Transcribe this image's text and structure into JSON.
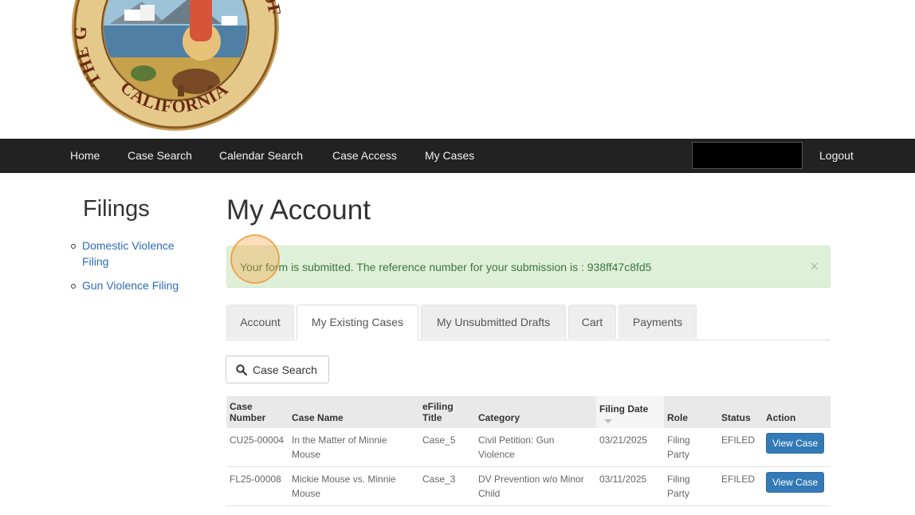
{
  "seal": {
    "text_left": "THE G",
    "text_right": "ATE OF",
    "text_bottom": "CALIFORNIA"
  },
  "nav": {
    "items": [
      "Home",
      "Case Search",
      "Calendar Search",
      "Case Access",
      "My Cases"
    ],
    "logout": "Logout"
  },
  "sidebar": {
    "title": "Filings",
    "links": [
      "Domestic Violence Filing",
      "Gun Violence Filing"
    ]
  },
  "main": {
    "title": "My Account",
    "alert": {
      "message": "Your form is submitted. The reference number for your submission is : 938ff47c8fd5",
      "close": "×"
    },
    "tabs": [
      "Account",
      "My Existing Cases",
      "My Unsubmitted Drafts",
      "Cart",
      "Payments"
    ],
    "active_tab": "My Existing Cases",
    "search_button": "Case Search",
    "table": {
      "headers": [
        "Case Number",
        "Case Name",
        "eFiling Title",
        "Category",
        "Filing Date",
        "Role",
        "Status",
        "Action"
      ],
      "rows": [
        {
          "case_number": "CU25-00004",
          "case_name": "In the Matter of Minnie Mouse",
          "efiling_title": "Case_5",
          "category": "Civil Petition: Gun Violence",
          "filing_date": "03/21/2025",
          "role": "Filing Party",
          "status": "EFILED",
          "action": "View Case"
        },
        {
          "case_number": "FL25-00008",
          "case_name": "Mickie Mouse vs. Minnie Mouse",
          "efiling_title": "Case_3",
          "category": "DV Prevention w/o Minor Child",
          "filing_date": "03/11/2025",
          "role": "Filing Party",
          "status": "EFILED",
          "action": "View Case"
        }
      ]
    }
  },
  "colors": {
    "navbar": "#222222",
    "link": "#2a6bb6",
    "alert_bg": "#dff0d8",
    "alert_text": "#3c763d",
    "button_primary": "#337ab7"
  }
}
